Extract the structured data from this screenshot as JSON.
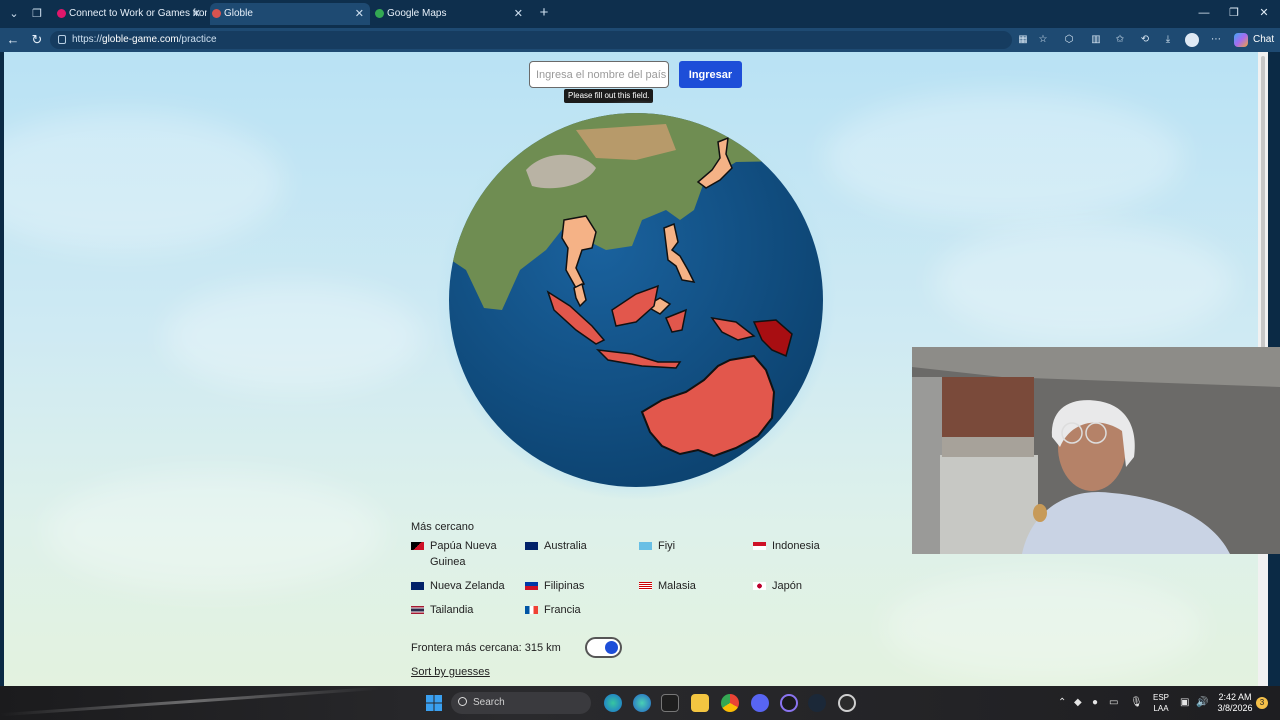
{
  "browser": {
    "tabs": [
      {
        "title": "Connect to Work or Games from A",
        "favicon_color": "#e0176b",
        "active": false
      },
      {
        "title": "Globle",
        "favicon_color": "#d9534f",
        "active": true
      },
      {
        "title": "Google Maps",
        "favicon_color": "#34a853",
        "active": false
      }
    ],
    "url_scheme": "https://",
    "url_host": "globle-game.com",
    "url_path": "/practice",
    "chat_label": "Chat"
  },
  "game": {
    "input_placeholder": "Ingresa el nombre del país",
    "submit_label": "Ingresar",
    "tooltip": "Please fill out this field.",
    "closest_title": "Más cercano",
    "guesses": [
      {
        "name": "Papúa Nueva Guinea",
        "flag": "png"
      },
      {
        "name": "Australia",
        "flag": "aus"
      },
      {
        "name": "Fiyi",
        "flag": "fji"
      },
      {
        "name": "Indonesia",
        "flag": "idn"
      },
      {
        "name": "Nueva Zelanda",
        "flag": "nzl"
      },
      {
        "name": "Filipinas",
        "flag": "phl"
      },
      {
        "name": "Malasia",
        "flag": "mys"
      },
      {
        "name": "Japón",
        "flag": "jpn"
      },
      {
        "name": "Tailandia",
        "flag": "tha"
      },
      {
        "name": "Francia",
        "flag": "fra"
      }
    ],
    "closest_border_label": "Frontera más cercana:",
    "closest_border_value": "315",
    "closest_border_unit": "km",
    "toggle_on": true,
    "sort_link": "Sort by guesses"
  },
  "colors": {
    "accent": "#1d4ed8",
    "ocean": "#0f4f86",
    "guess_hot": "#e2574c",
    "guess_warm": "#f5b286",
    "guess_hottest": "#a80e12"
  },
  "taskbar": {
    "search_label": "Search",
    "language": "ESP",
    "layout": "LAA",
    "time": "2:42 AM",
    "date": "3/8/2026",
    "notifications": "3",
    "apps": [
      "windows-start-icon",
      "edge-icon",
      "edge-icon",
      "terminal-icon",
      "file-explorer-icon",
      "chrome-icon",
      "discord-icon",
      "app-icon",
      "steam-icon",
      "obs-icon"
    ]
  }
}
